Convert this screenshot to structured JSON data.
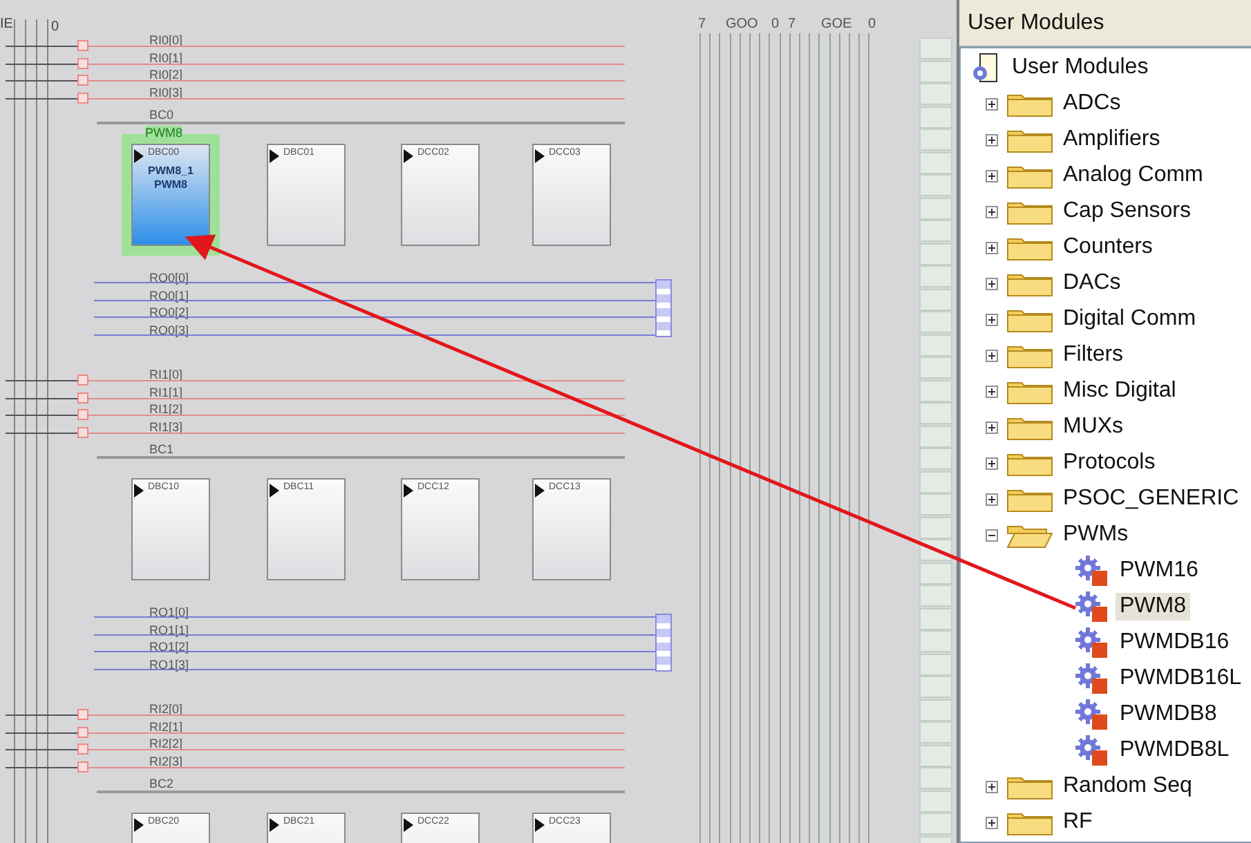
{
  "canvas": {
    "corner_labels": [
      "IE",
      "0"
    ],
    "bus_header": [
      "7",
      "GOO",
      "0",
      "7",
      "GOE",
      "0"
    ],
    "groups": [
      {
        "input_rows": [
          "RI0[0]",
          "RI0[1]",
          "RI0[2]",
          "RI0[3]"
        ],
        "clock_label": "BC0",
        "blocks": [
          {
            "name": "DBC00",
            "selected": true,
            "module": {
              "tag": "PWM8",
              "instance": "PWM8_1",
              "type": "PWM8"
            }
          },
          {
            "name": "DBC01",
            "selected": false
          },
          {
            "name": "DCC02",
            "selected": false
          },
          {
            "name": "DCC03",
            "selected": false
          }
        ],
        "output_rows": [
          "RO0[0]",
          "RO0[1]",
          "RO0[2]",
          "RO0[3]"
        ]
      },
      {
        "input_rows": [
          "RI1[0]",
          "RI1[1]",
          "RI1[2]",
          "RI1[3]"
        ],
        "clock_label": "BC1",
        "blocks": [
          {
            "name": "DBC10",
            "selected": false
          },
          {
            "name": "DBC11",
            "selected": false
          },
          {
            "name": "DCC12",
            "selected": false
          },
          {
            "name": "DCC13",
            "selected": false
          }
        ],
        "output_rows": [
          "RO1[0]",
          "RO1[1]",
          "RO1[2]",
          "RO1[3]"
        ]
      },
      {
        "input_rows": [
          "RI2[0]",
          "RI2[1]",
          "RI2[2]",
          "RI2[3]"
        ],
        "clock_label": "BC2",
        "blocks": [
          {
            "name": "DBC20",
            "selected": false
          },
          {
            "name": "DBC21",
            "selected": false
          },
          {
            "name": "DCC22",
            "selected": false
          },
          {
            "name": "DCC23",
            "selected": false
          }
        ]
      }
    ]
  },
  "panel": {
    "title": "User Modules",
    "tree": [
      {
        "label": "User Modules",
        "kind": "root",
        "selected": false,
        "children": [
          {
            "label": "ADCs",
            "kind": "folder",
            "expanded": false,
            "selected": false
          },
          {
            "label": "Amplifiers",
            "kind": "folder",
            "expanded": false,
            "selected": false
          },
          {
            "label": "Analog Comm",
            "kind": "folder",
            "expanded": false,
            "selected": false
          },
          {
            "label": "Cap Sensors",
            "kind": "folder",
            "expanded": false,
            "selected": false
          },
          {
            "label": "Counters",
            "kind": "folder",
            "expanded": false,
            "selected": false
          },
          {
            "label": "DACs",
            "kind": "folder",
            "expanded": false,
            "selected": false
          },
          {
            "label": "Digital Comm",
            "kind": "folder",
            "expanded": false,
            "selected": false
          },
          {
            "label": "Filters",
            "kind": "folder",
            "expanded": false,
            "selected": false
          },
          {
            "label": "Misc Digital",
            "kind": "folder",
            "expanded": false,
            "selected": false
          },
          {
            "label": "MUXs",
            "kind": "folder",
            "expanded": false,
            "selected": false
          },
          {
            "label": "Protocols",
            "kind": "folder",
            "expanded": false,
            "selected": false
          },
          {
            "label": "PSOC_GENERIC",
            "kind": "folder",
            "expanded": false,
            "selected": false
          },
          {
            "label": "PWMs",
            "kind": "folder",
            "expanded": true,
            "selected": false,
            "children": [
              {
                "label": "PWM16",
                "kind": "module",
                "selected": false
              },
              {
                "label": "PWM8",
                "kind": "module",
                "selected": true
              },
              {
                "label": "PWMDB16",
                "kind": "module",
                "selected": false
              },
              {
                "label": "PWMDB16L",
                "kind": "module",
                "selected": false
              },
              {
                "label": "PWMDB8",
                "kind": "module",
                "selected": false
              },
              {
                "label": "PWMDB8L",
                "kind": "module",
                "selected": false
              }
            ]
          },
          {
            "label": "Random Seq",
            "kind": "folder",
            "expanded": false,
            "selected": false
          },
          {
            "label": "RF",
            "kind": "folder",
            "expanded": false,
            "selected": false
          }
        ]
      }
    ]
  }
}
